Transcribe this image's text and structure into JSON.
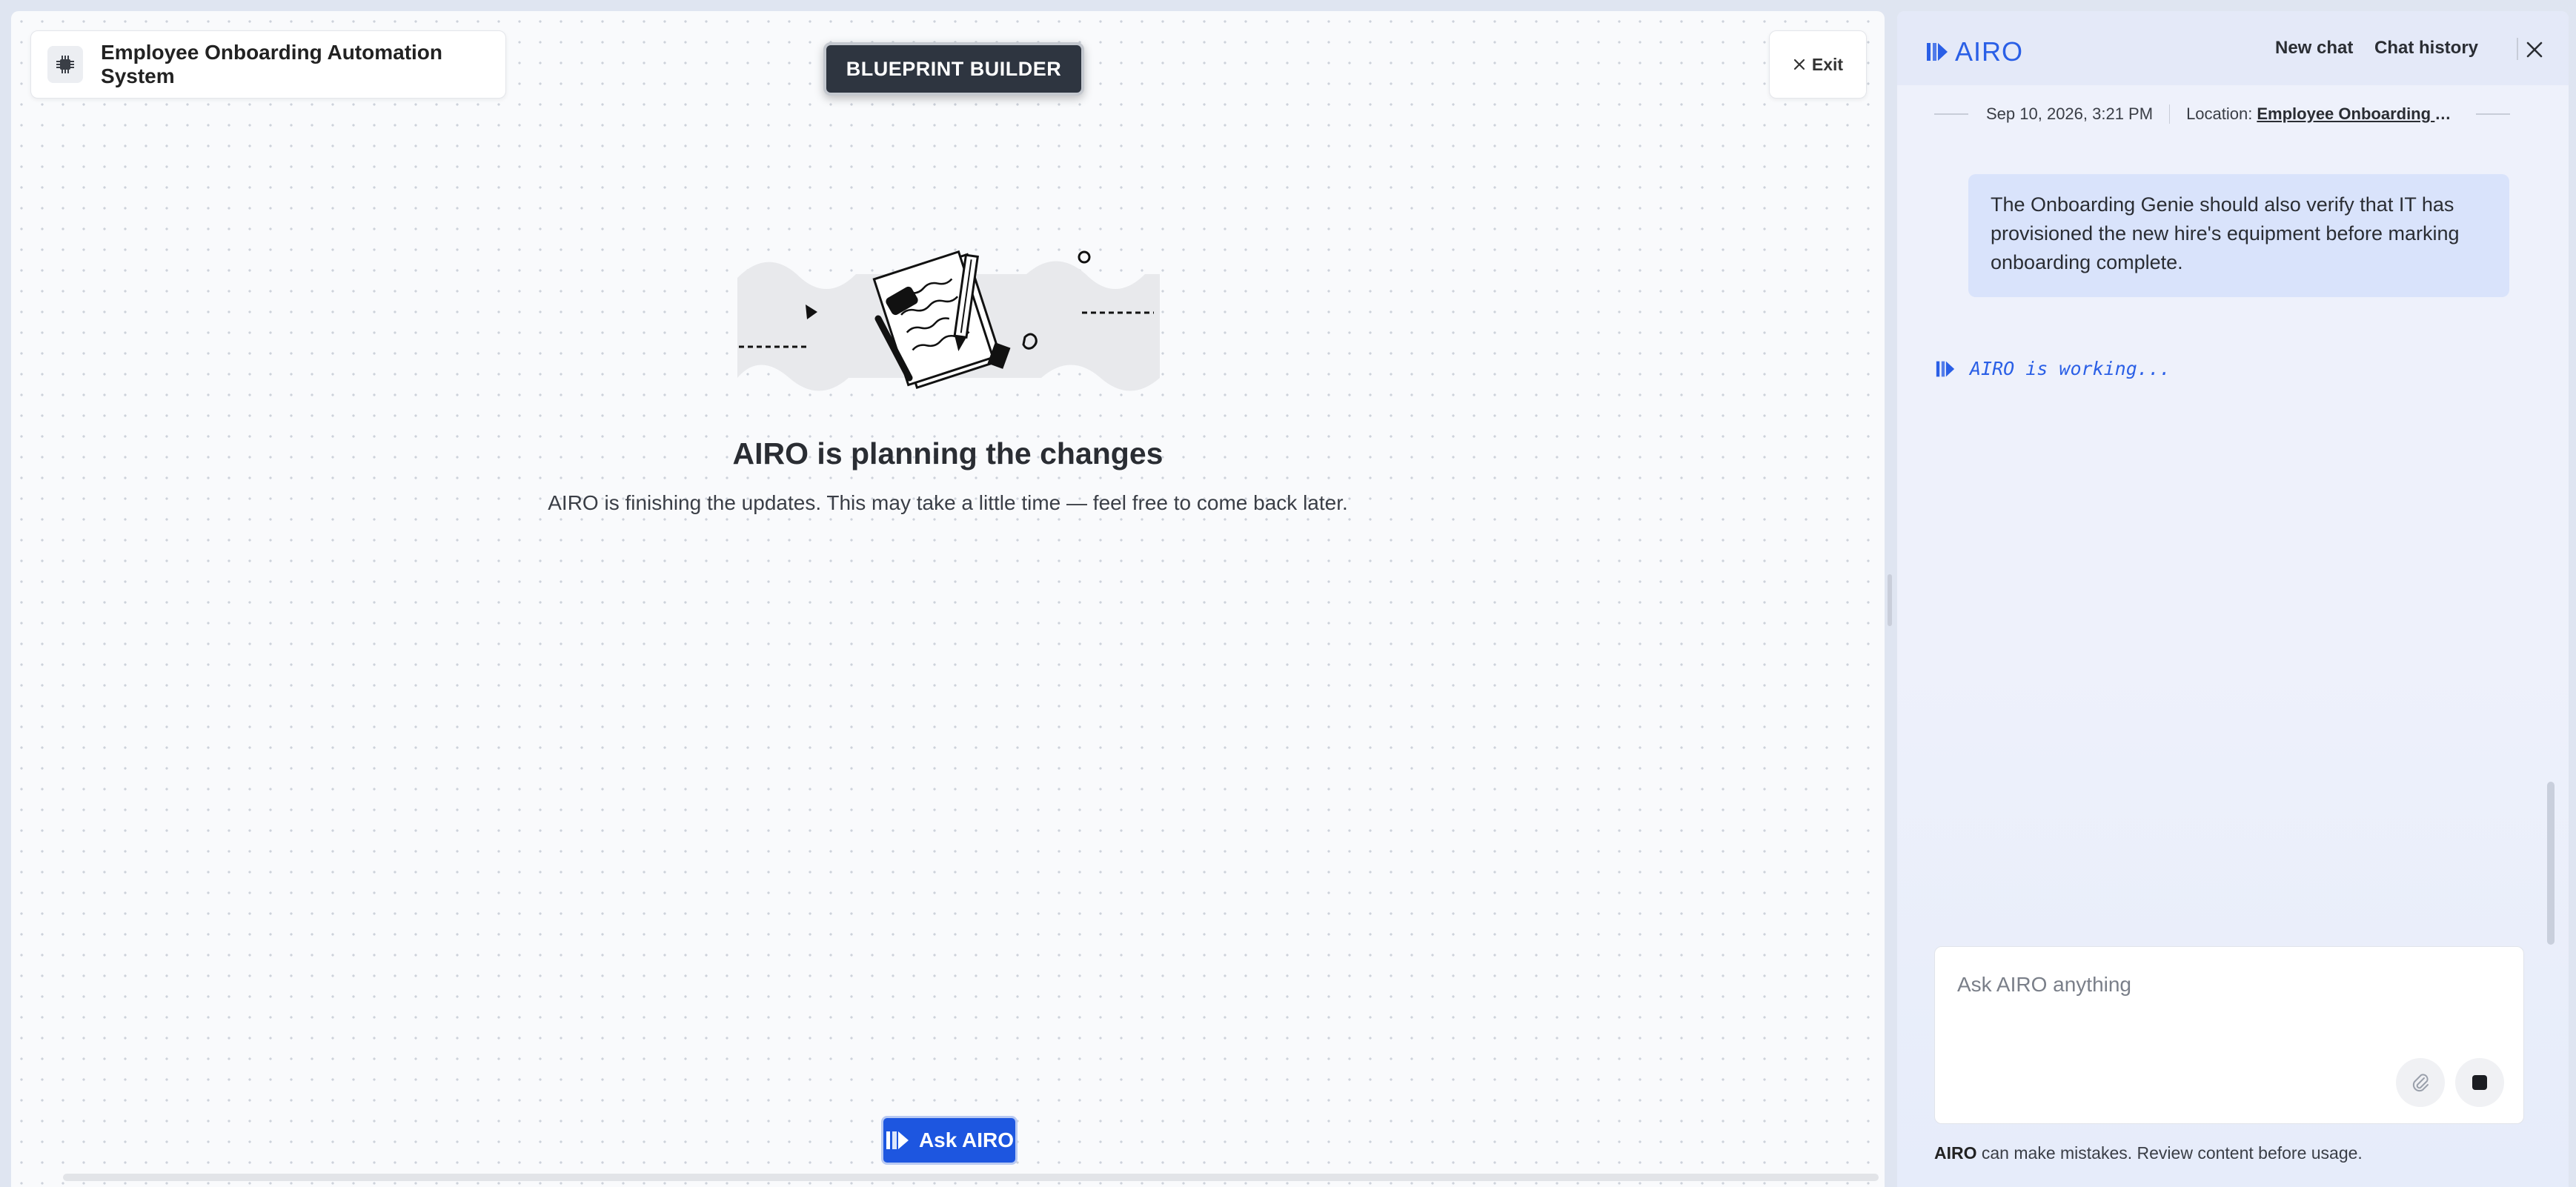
{
  "canvas": {
    "project_title": "Employee Onboarding Automation System",
    "mode_badge": "BLUEPRINT BUILDER",
    "exit_label": "Exit",
    "status_heading": "AIRO is planning the changes",
    "status_message": "AIRO is finishing the updates. This may take a little time — feel free to come back later.",
    "ask_button_label": "Ask AIRO",
    "icons": [
      "chip-icon",
      "close-icon",
      "planning-illustration",
      "airo-icon"
    ]
  },
  "chat": {
    "brand": "AIRO",
    "new_chat_label": "New chat",
    "chat_history_label": "Chat history",
    "meta": {
      "date": "Sep 10, 2026, 3:21 PM",
      "location_label": "Location:",
      "location_value": "Employee Onboarding Automation System"
    },
    "user_message": "The Onboarding Genie should also verify that IT has provisioned the new hire's equipment before marking onboarding complete.",
    "working_text": "AIRO is working...",
    "input": {
      "placeholder": "Ask AIRO anything",
      "value": ""
    },
    "disclaimer_brand": "AIRO",
    "disclaimer_text": " can make mistakes. Review content before usage.",
    "accent_color": "#2a5fe6",
    "button_color": "#1d56e0"
  }
}
